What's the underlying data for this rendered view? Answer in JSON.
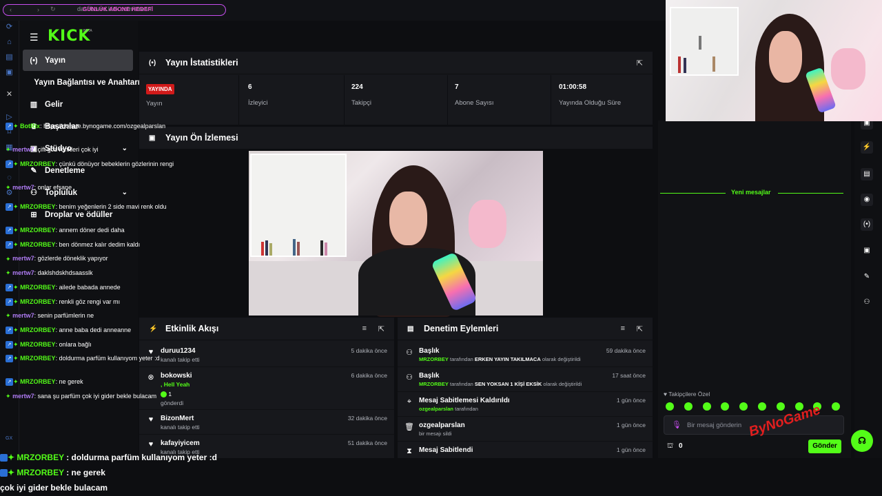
{
  "browser": {
    "url": "dashboard.kick.com/stream",
    "goal_overlay": "GÜNLÜK ABONE HEDEFİ"
  },
  "brand": {
    "logo": "KICK",
    "beta": "BETA"
  },
  "nav": [
    {
      "label": "Yayın",
      "icon": "broadcast-icon",
      "active": true
    },
    {
      "label": "Yayın Bağlantısı ve Anahtarı",
      "icon": ""
    },
    {
      "label": "Gelir",
      "icon": "chart-icon"
    },
    {
      "label": "Başarılar",
      "icon": "trophy-icon"
    },
    {
      "label": "Stüdyo",
      "icon": "studio-icon",
      "expandable": true
    },
    {
      "label": "Denetleme",
      "icon": "wrench-icon"
    },
    {
      "label": "Topluluk",
      "icon": "community-icon",
      "expandable": true
    },
    {
      "label": "Droplar ve ödüller",
      "icon": "gift-icon"
    }
  ],
  "stats": {
    "title": "Yayın İstatistikleri",
    "live_badge": "YAYINDA",
    "items": [
      {
        "value": "",
        "label": "Yayın"
      },
      {
        "value": "6",
        "label": "İzleyici"
      },
      {
        "value": "224",
        "label": "Takipçi"
      },
      {
        "value": "7",
        "label": "Abone Sayısı"
      },
      {
        "value": "01:00:58",
        "label": "Yayında Olduğu Süre"
      }
    ]
  },
  "preview": {
    "title": "Yayın Ön İzlemesi"
  },
  "activity": {
    "title": "Etkinlik Akışı",
    "rows": [
      {
        "user": "duruu1234",
        "sub": "kanalı takip etti",
        "time": "5 dakika önce",
        "icon": "heart-icon"
      },
      {
        "user": "bokowski",
        "extra": ", Hell Yeah",
        "count": "1",
        "sub": "gönderdi",
        "time": "6 dakika önce",
        "icon": "kick-coin-icon"
      },
      {
        "user": "BizonMert",
        "sub": "kanalı takip etti",
        "time": "32 dakika önce",
        "icon": "heart-icon"
      },
      {
        "user": "kafayiyicem",
        "sub": "kanalı takip etti",
        "time": "51 dakika önce",
        "icon": "heart-icon"
      }
    ]
  },
  "moderation": {
    "title": "Denetim Eylemleri",
    "rows": [
      {
        "title": "Başlık",
        "by": "MRZORBEY",
        "mid": "tarafından",
        "val": "ERKEN YAYIN TAKILMACA",
        "end": "olarak değiştirildi",
        "time": "59 dakika önce",
        "icon": "user-edit-icon"
      },
      {
        "title": "Başlık",
        "by": "MRZORBEY",
        "mid": "tarafından",
        "val": "SEN YOKSAN 1 KİŞİ EKSİK",
        "end": "olarak değiştirildi",
        "time": "17 saat önce",
        "icon": "user-edit-icon"
      },
      {
        "title": "Mesaj Sabitlemesi Kaldırıldı",
        "by": "ozgealparslan",
        "mid": "tarafından",
        "val": "",
        "end": "",
        "time": "1 gün önce",
        "icon": "unpin-icon"
      },
      {
        "title": "ozgealparslan",
        "by": "",
        "mid": "bir mesajı sildi",
        "val": "",
        "end": "",
        "time": "1 gün önce",
        "icon": "trash-icon"
      },
      {
        "title": "Mesaj Sabitlendi",
        "by": "",
        "mid": "",
        "val": "",
        "end": "",
        "time": "1 gün önce",
        "icon": "pin-icon"
      }
    ]
  },
  "chat": {
    "messages": [
      {
        "user": "BotRix",
        "cls": "u-green",
        "text": "https://donate.bynogame.com/ozgealparslan",
        "badge": true
      },
      {
        "user": "mertw7",
        "cls": "u-purple",
        "text": "çift göz renkleri çok iyi"
      },
      {
        "user": "MRZORBEY",
        "cls": "u-green",
        "text": "çünkü dönüyor bebeklerin gözlerinin rengi",
        "badge": true
      },
      {
        "user": "mertw7",
        "cls": "u-purple",
        "text": "onlar efsane"
      }
    ],
    "new_label": "Yeni mesajlar",
    "new_messages": [
      {
        "user": "MRZORBEY",
        "cls": "u-green",
        "text": "benim yeğenlerin 2 side mavi renk oldu",
        "badge": true
      },
      {
        "user": "MRZORBEY",
        "cls": "u-green",
        "text": "annem döner dedi daha",
        "badge": true
      },
      {
        "user": "MRZORBEY",
        "cls": "u-green",
        "text": "ben dönmez kalır dedim kaldı",
        "badge": true
      },
      {
        "user": "mertw7",
        "cls": "u-purple",
        "text": "gözlerde döneklik yapıyor"
      },
      {
        "user": "mertw7",
        "cls": "u-purple",
        "text": "daklshdskhdsaasslk"
      },
      {
        "user": "MRZORBEY",
        "cls": "u-green",
        "text": "ailede babada annede",
        "badge": true
      },
      {
        "user": "MRZORBEY",
        "cls": "u-green",
        "text": "renkli göz rengi var mı",
        "badge": true
      },
      {
        "user": "mertw7",
        "cls": "u-purple",
        "text": "senin parfümlerin ne"
      },
      {
        "user": "MRZORBEY",
        "cls": "u-green",
        "text": "anne baba dedi anneanne",
        "badge": true
      },
      {
        "user": "MRZORBEY",
        "cls": "u-green",
        "text": "onlara bağlı",
        "badge": true
      },
      {
        "user": "MRZORBEY",
        "cls": "u-green",
        "text": "doldurma parfüm kullanıyom yeter :d",
        "badge": true
      },
      {
        "user": "MRZORBEY",
        "cls": "u-green",
        "text": "ne gerek",
        "badge": true
      },
      {
        "user": "mertw7",
        "cls": "u-purple",
        "text": "sana şu parfüm çok iyi gider bekle bulacam"
      }
    ],
    "followers_only": "Takipçilere Özel",
    "placeholder": "Bir mesaj gönderin",
    "send": "Gönder",
    "points": "0"
  },
  "overlay": {
    "lines": [
      {
        "user": "MRZORBEY",
        "text": "doldurma parfüm kullanıyom yeter :d"
      },
      {
        "user": "MRZORBEY",
        "text": "ne gerek"
      },
      {
        "user": "",
        "text": "çok iyi gider bekle bulacam"
      }
    ],
    "sponsor": "ByNoGame"
  }
}
